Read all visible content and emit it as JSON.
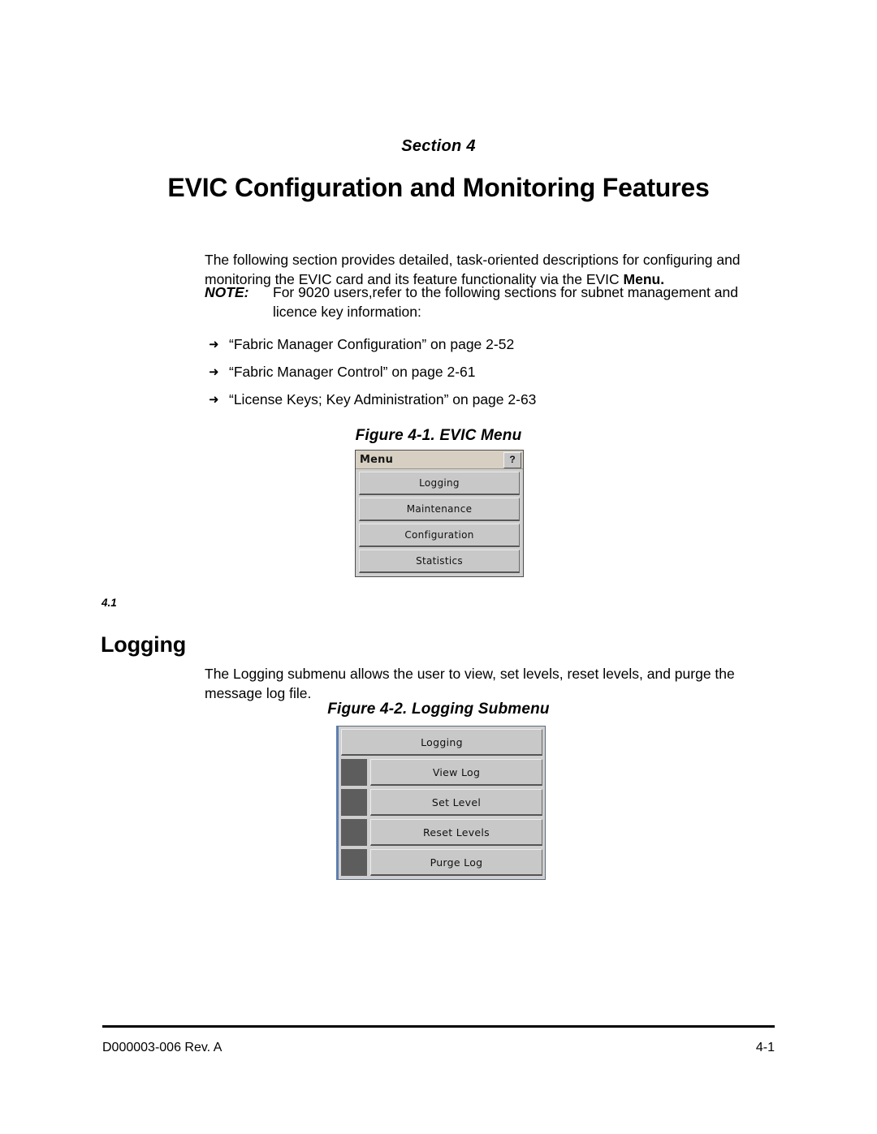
{
  "header": {
    "section_label": "Section 4",
    "document_title": "EVIC Configuration and Monitoring Features"
  },
  "intro": {
    "paragraph_part1": "The following section provides detailed, task-oriented descriptions for configuring and monitoring the EVIC card and its feature functionality via the EVIC ",
    "paragraph_bold": "Menu.",
    "note_label": "NOTE:",
    "note_text": "For 9020 users,refer to the following sections for subnet management and licence key information:"
  },
  "bullets": [
    {
      "glyph": "➜",
      "text": "“Fabric Manager Configuration” on page 2-52"
    },
    {
      "glyph": "➜",
      "text": "“Fabric Manager Control” on page 2-61"
    },
    {
      "glyph": "➜",
      "text": "“License Keys; Key Administration” on page 2-63"
    }
  ],
  "figure1": {
    "caption": "Figure 4-1. EVIC Menu",
    "window_title": "Menu",
    "help_label": "?",
    "buttons": [
      {
        "label": "Logging"
      },
      {
        "label": "Maintenance"
      },
      {
        "label": "Configuration"
      },
      {
        "label": "Statistics"
      }
    ]
  },
  "section_logging": {
    "number": "4.1",
    "heading": "Logging",
    "paragraph": "The Logging submenu allows the user to view, set levels, reset levels, and purge the message log file."
  },
  "figure2": {
    "caption": "Figure 4-2. Logging Submenu",
    "header_button": {
      "label": "Logging"
    },
    "items": [
      {
        "label": "View Log"
      },
      {
        "label": "Set Level"
      },
      {
        "label": "Reset Levels"
      },
      {
        "label": "Purge Log"
      }
    ]
  },
  "footer": {
    "document_number": "D000003-006 Rev. A",
    "page_number": "4-1"
  },
  "colors": {
    "page_background": "#ffffff",
    "text": "#000000",
    "button_face": "#c8c8c8",
    "titlebar": "#d6cfc2",
    "swatch_dark": "#5d5d5d",
    "frame_blue": "#5d7fb0"
  }
}
